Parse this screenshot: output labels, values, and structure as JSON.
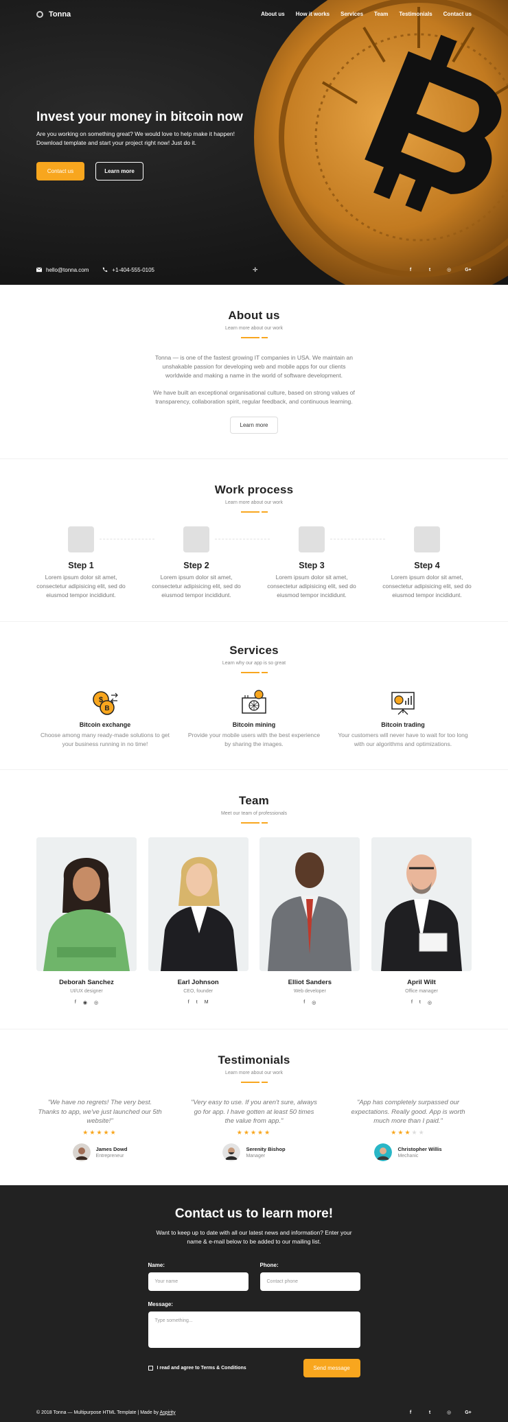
{
  "brand": "Tonna",
  "nav": [
    "About us",
    "How it works",
    "Services",
    "Team",
    "Testimonials",
    "Contact us"
  ],
  "hero": {
    "title": "Invest your money in bitcoin now",
    "subtitle_line1": "Are you working on something great? We would love to help make it happen!",
    "subtitle_line2": "Download template and start your project right now! Just do it.",
    "btn_contact": "Contact us",
    "btn_learn": "Learn more",
    "email": "hello@tonna.com",
    "phone": "+1-404-555-0105"
  },
  "about": {
    "title": "About us",
    "subtitle": "Learn more about our work",
    "p1": "Tonna — is one of the fastest growing IT companies in USA. We maintain an unshakable passion for developing web and mobile apps for our clients worldwide and making a name in the world of software development.",
    "p2": "We have built an exceptional organisational culture, based on strong values of transparency, collaboration spirit, regular feedback, and continuous learning.",
    "btn": "Learn more"
  },
  "process": {
    "title": "Work process",
    "subtitle": "Learn more about our work",
    "steps": [
      {
        "title": "Step 1",
        "text": "Lorem ipsum dolor sit amet, consectetur adipisicing elit, sed do eiusmod tempor incididunt."
      },
      {
        "title": "Step 2",
        "text": "Lorem ipsum dolor sit amet, consectetur adipisicing elit, sed do eiusmod tempor incididunt."
      },
      {
        "title": "Step 3",
        "text": "Lorem ipsum dolor sit amet, consectetur adipisicing elit, sed do eiusmod tempor incididunt."
      },
      {
        "title": "Step 4",
        "text": "Lorem ipsum dolor sit amet, consectetur adipisicing elit, sed do eiusmod tempor incididunt."
      }
    ]
  },
  "services": {
    "title": "Services",
    "subtitle": "Learn why our app is so great",
    "items": [
      {
        "title": "Bitcoin exchange",
        "text": "Choose among many ready-made solutions to get your business running in no time!",
        "icon": "coin-exchange-icon"
      },
      {
        "title": "Bitcoin mining",
        "text": "Provide your mobile users with the best experience by sharing the images.",
        "icon": "mining-icon"
      },
      {
        "title": "Bitcoin trading",
        "text": "Your customers will never have to wait for too long with our algorithms and optimizations.",
        "icon": "trading-board-icon"
      }
    ]
  },
  "team": {
    "title": "Team",
    "subtitle": "Meet our team of professionals",
    "members": [
      {
        "name": "Deborah Sanchez",
        "role": "UI/UX designer",
        "social": [
          "f",
          "◉",
          "◎"
        ]
      },
      {
        "name": "Earl Johnson",
        "role": "CEO, founder",
        "social": [
          "f",
          "t",
          "M"
        ]
      },
      {
        "name": "Elliot Sanders",
        "role": "Web developer",
        "social": [
          "f",
          "◎"
        ]
      },
      {
        "name": "April Wilt",
        "role": "Office manager",
        "social": [
          "f",
          "t",
          "◎"
        ]
      }
    ]
  },
  "testimonials": {
    "title": "Testimonials",
    "subtitle": "Learn more about our work",
    "items": [
      {
        "text": "\"We have no regrets! The very best. Thanks to app, we've just launched our 5th website!\"",
        "rating": 5,
        "name": "James Dowd",
        "role": "Entrepreneur"
      },
      {
        "text": "\"Very easy to use. If you aren't sure, always go for app. I have gotten at least 50 times the value from app.\"",
        "rating": 5,
        "name": "Serenity Bishop",
        "role": "Manager"
      },
      {
        "text": "\"App has completely surpassed our expectations. Really good. App is worth much more than I paid.\"",
        "rating": 3,
        "name": "Christopher Willis",
        "role": "Mechanic"
      }
    ]
  },
  "contact": {
    "title": "Contact us to learn more!",
    "subtitle": "Want to keep up to date with all our latest news and information? Enter your name & e-mail below to be added to our mailing list.",
    "name_label": "Name:",
    "name_placeholder": "Your name",
    "phone_label": "Phone:",
    "phone_placeholder": "Contact phone",
    "message_label": "Message:",
    "message_placeholder": "Type something...",
    "agree": "I read and agree to Terms & Conditions",
    "send": "Send message"
  },
  "footer": {
    "copyright": "© 2018 Tonna — Multipurpose HTML Template | Made by",
    "author": "Aspirity"
  },
  "colors": {
    "accent": "#f8a61e",
    "dark": "#222222"
  }
}
